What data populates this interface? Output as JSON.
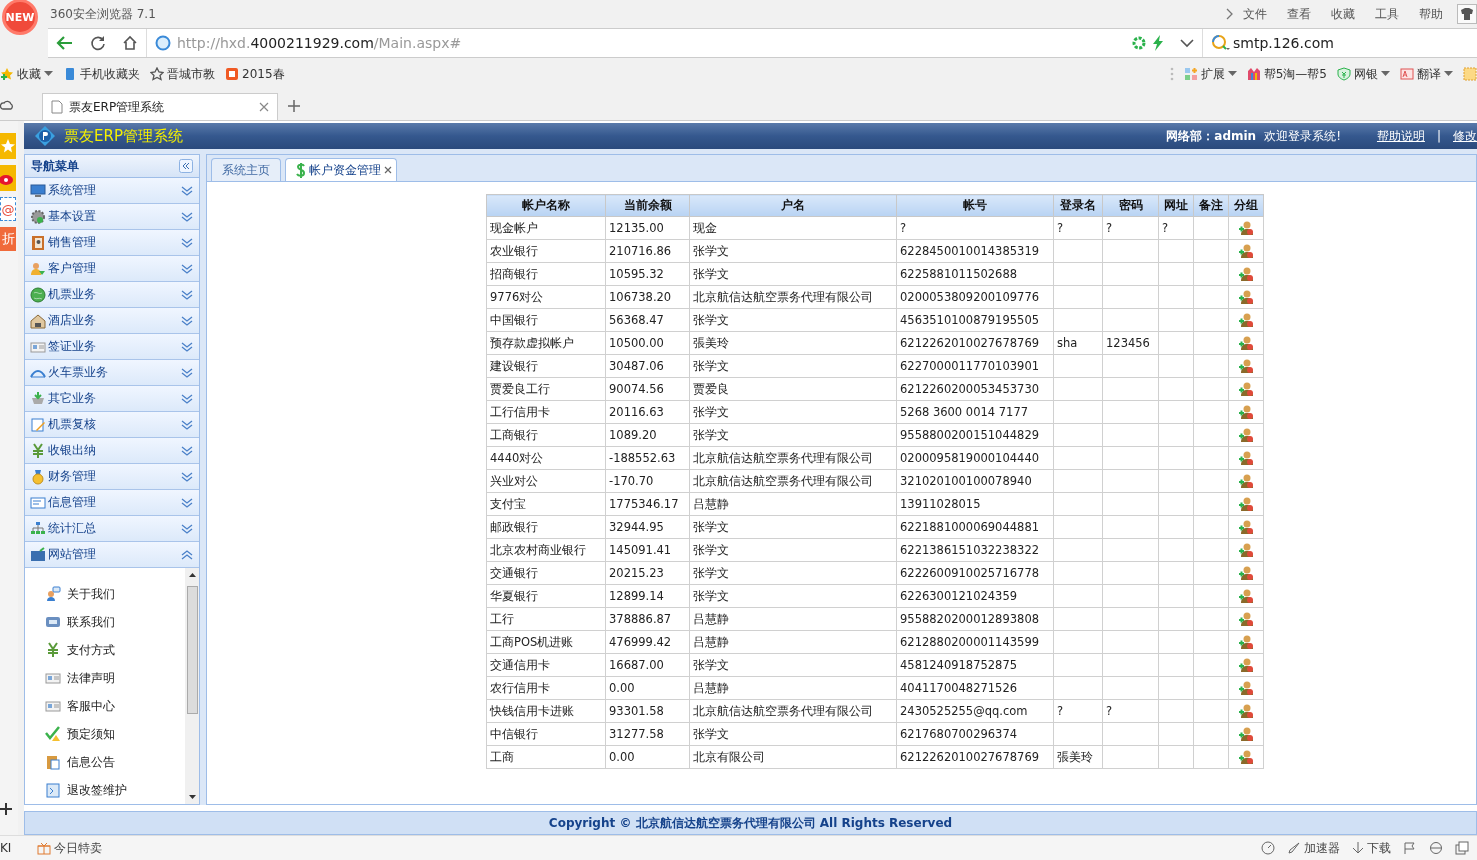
{
  "browser": {
    "title": "360安全浏览器 7.1",
    "badge": "NEW",
    "menu": [
      "文件",
      "查看",
      "收藏",
      "工具",
      "帮助"
    ],
    "url": [
      {
        "text": "http://hxd.",
        "emphasis": false
      },
      {
        "text": "4000211929.com",
        "emphasis": true
      },
      {
        "text": "/Main.aspx#",
        "emphasis": false
      }
    ],
    "search": {
      "value": "smtp.126.com"
    },
    "bookmarks": [
      {
        "label": "收藏",
        "dropdown": true
      },
      {
        "label": "手机收藏夹",
        "dropdown": false
      },
      {
        "label": "晋城市教",
        "dropdown": false
      },
      {
        "label": "2015春",
        "dropdown": false
      }
    ],
    "tools": [
      {
        "label": "扩展",
        "dropdown": true
      },
      {
        "label": "帮5淘—帮5",
        "dropdown": false
      },
      {
        "label": "网银",
        "dropdown": true
      },
      {
        "label": "翻译",
        "dropdown": true
      }
    ],
    "tabs": [
      {
        "label": "票友ERP管理系统",
        "selected": true
      }
    ],
    "side_strip": [
      "@",
      "折"
    ],
    "status_left": [
      "KI",
      "今日特卖"
    ],
    "status_right": [
      "加速器",
      "下载"
    ]
  },
  "app": {
    "title": "票友ERP管理系统",
    "user": "网络部：admin",
    "welcome": "欢迎登录系统!",
    "links": [
      "帮助说明",
      "修改"
    ],
    "separator": "|",
    "nav": {
      "title": "导航菜单",
      "items": [
        {
          "label": "系统管理",
          "expanded": false
        },
        {
          "label": "基本设置",
          "expanded": false
        },
        {
          "label": "销售管理",
          "expanded": false
        },
        {
          "label": "客户管理",
          "expanded": false
        },
        {
          "label": "机票业务",
          "expanded": false
        },
        {
          "label": "酒店业务",
          "expanded": false
        },
        {
          "label": "签证业务",
          "expanded": false
        },
        {
          "label": "火车票业务",
          "expanded": false
        },
        {
          "label": "其它业务",
          "expanded": false
        },
        {
          "label": "机票复核",
          "expanded": false
        },
        {
          "label": "收银出纳",
          "expanded": false
        },
        {
          "label": "财务管理",
          "expanded": false
        },
        {
          "label": "信息管理",
          "expanded": false
        },
        {
          "label": "统计汇总",
          "expanded": false
        },
        {
          "label": "网站管理",
          "expanded": true,
          "children": [
            "关于我们",
            "联系我们",
            "支付方式",
            "法律声明",
            "客服中心",
            "预定须知",
            "信息公告",
            "退改签维护"
          ]
        }
      ]
    },
    "tabs": [
      {
        "label": "系统主页",
        "selected": false
      },
      {
        "label": "帐户资金管理",
        "selected": true
      }
    ],
    "table": {
      "columns": [
        "帐户名称",
        "当前余额",
        "户名",
        "帐号",
        "登录名",
        "密码",
        "网址",
        "备注",
        "分组"
      ],
      "rows": [
        {
          "name": "现金帐户",
          "balance": "12135.00",
          "holder": "现金",
          "account": "?",
          "login": "?",
          "password": "?",
          "url": "?"
        },
        {
          "name": "农业银行",
          "balance": "210716.86",
          "holder": "张学文",
          "account": "6228450010014385319"
        },
        {
          "name": "招商银行",
          "balance": "10595.32",
          "holder": "张学文",
          "account": "6225881011502688"
        },
        {
          "name": "9776对公",
          "balance": "106738.20",
          "holder": "北京航信达航空票务代理有限公司",
          "account": "0200053809200109776"
        },
        {
          "name": "中国银行",
          "balance": "56368.47",
          "holder": "张学文",
          "account": "4563510100879195505"
        },
        {
          "name": "预存款虚拟帐户",
          "balance": "10500.00",
          "holder": "張美玲",
          "account": "6212262010027678769",
          "login": "sha",
          "password": "123456"
        },
        {
          "name": "建设银行",
          "balance": "30487.06",
          "holder": "张学文",
          "account": "6227000011770103901"
        },
        {
          "name": "贾爱良工行",
          "balance": "90074.56",
          "holder": "贾爱良",
          "account": "6212260200053453730"
        },
        {
          "name": "工行信用卡",
          "balance": "20116.63",
          "holder": "张学文",
          "account": "5268 3600 0014 7177"
        },
        {
          "name": "工商银行",
          "balance": "1089.20",
          "holder": "张学文",
          "account": "9558800200151044829"
        },
        {
          "name": "4440对公",
          "balance": "-188552.63",
          "holder": "北京航信达航空票务代理有限公司",
          "account": "0200095819000104440"
        },
        {
          "name": "兴业对公",
          "balance": "-170.70",
          "holder": "北京航信达航空票务代理有限公司",
          "account": "321020100100078940"
        },
        {
          "name": "支付宝",
          "balance": "1775346.17",
          "holder": "吕慧静",
          "account": "13911028015"
        },
        {
          "name": "邮政银行",
          "balance": "32944.95",
          "holder": "张学文",
          "account": "6221881000069044881"
        },
        {
          "name": "北京农村商业银行",
          "balance": "145091.41",
          "holder": "张学文",
          "account": "6221386151032238322"
        },
        {
          "name": "交通银行",
          "balance": "20215.23",
          "holder": "张学文",
          "account": "6222600910025716778"
        },
        {
          "name": "华夏银行",
          "balance": "12899.14",
          "holder": "张学文",
          "account": "6226300121024359"
        },
        {
          "name": "工行",
          "balance": "378886.87",
          "holder": "吕慧静",
          "account": "9558820200012893808"
        },
        {
          "name": "工商POS机进账",
          "balance": "476999.42",
          "holder": "吕慧静",
          "account": "6212880200001143599"
        },
        {
          "name": "交通信用卡",
          "balance": "16687.00",
          "holder": "张学文",
          "account": "4581240918752875"
        },
        {
          "name": "农行信用卡",
          "balance": "0.00",
          "holder": "吕慧静",
          "account": "4041170048271526"
        },
        {
          "name": "快钱信用卡进账",
          "balance": "93301.58",
          "holder": "北京航信达航空票务代理有限公司",
          "account": "2430525255@qq.com",
          "login": "?",
          "password": "?"
        },
        {
          "name": "中信银行",
          "balance": "31277.58",
          "holder": "张学文",
          "account": "6217680700296374"
        },
        {
          "name": "工商",
          "balance": "0.00",
          "holder": "北京有限公司",
          "account": "6212262010027678769",
          "login": "張美玲"
        }
      ]
    },
    "footer": "Copyright © 北京航信达航空票务代理有限公司 All Rights Reserved"
  }
}
